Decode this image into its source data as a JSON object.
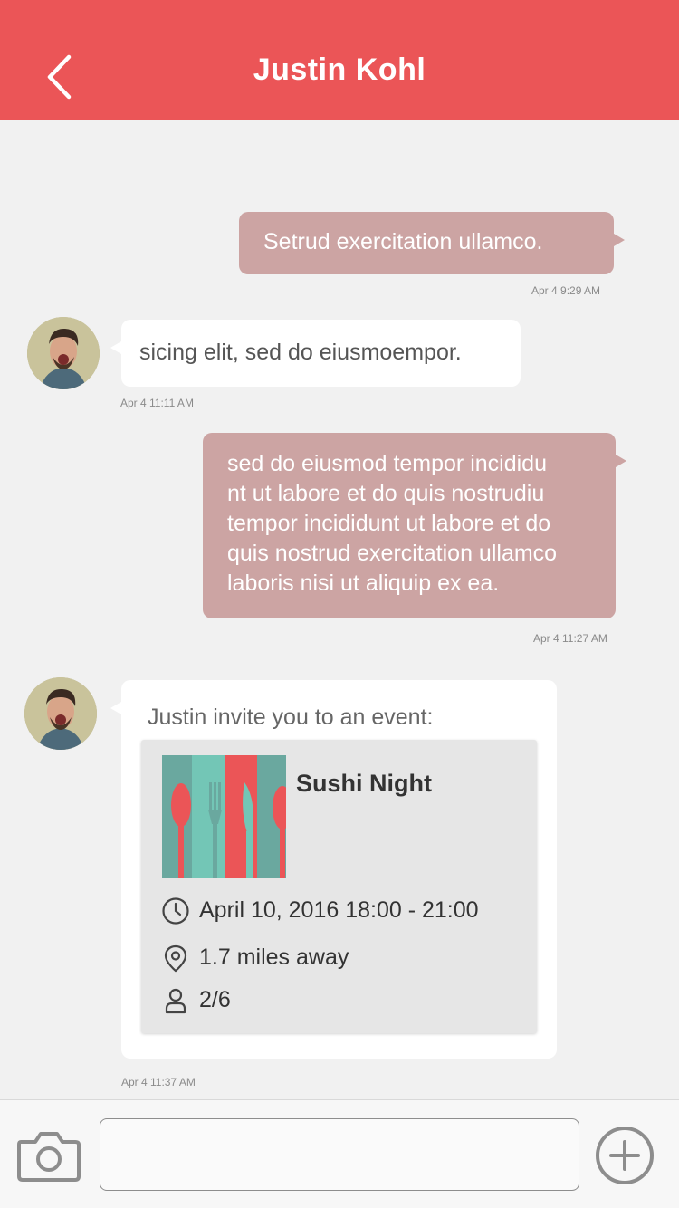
{
  "header": {
    "title": "Justin Kohl",
    "back_icon": "chevron-left-icon"
  },
  "messages": [
    {
      "direction": "outgoing",
      "text": "Setrud exercitation ullamco.",
      "time": "Apr 4 9:29 AM"
    },
    {
      "direction": "incoming",
      "text": "sicing elit, sed do eiusmoempor.",
      "time": "Apr 4 11:11 AM"
    },
    {
      "direction": "outgoing",
      "lines": [
        "sed do eiusmod tempor incididu",
        "nt ut labore et do quis nostrudiu",
        "tempor incididunt ut labore et do",
        "quis nostrud exercitation ullamco",
        "laboris nisi ut aliquip ex ea."
      ],
      "time": "Apr 4 11:27 AM"
    },
    {
      "direction": "incoming",
      "type": "event",
      "time": "Apr 4 11:37 AM"
    }
  ],
  "event": {
    "intro": "Justin invite you to an event:",
    "title": "Sushi Night",
    "datetime": "April 10, 2016  18:00 - 21:00",
    "distance": "1.7 miles away",
    "attendees": "2/6",
    "colors": {
      "teal": "#73c6b6",
      "teal_dark": "#6aa89f",
      "red": "#eb5557"
    }
  },
  "input_bar": {
    "placeholder": "",
    "camera_icon": "camera-icon",
    "add_icon": "plus-circle-icon"
  },
  "colors": {
    "header": "#eb5557",
    "outgoing_bubble": "#cca4a3",
    "incoming_bubble": "#ffffff",
    "background": "#f1f1f1"
  }
}
